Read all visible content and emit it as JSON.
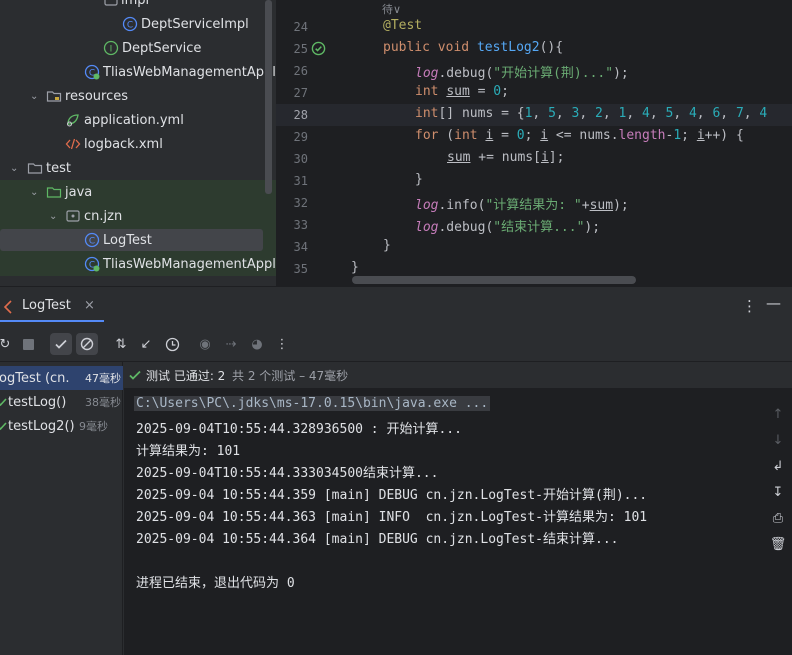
{
  "project_tree": {
    "items": [
      {
        "label": "impl",
        "kind": "package"
      },
      {
        "label": "DeptServiceImpl",
        "kind": "class"
      },
      {
        "label": "DeptService",
        "kind": "interface"
      },
      {
        "label": "TliasWebManagementApplic",
        "kind": "spring-class"
      },
      {
        "label": "resources",
        "kind": "folder"
      },
      {
        "label": "application.yml",
        "kind": "yaml"
      },
      {
        "label": "logback.xml",
        "kind": "xml"
      },
      {
        "label": "test",
        "kind": "folder"
      },
      {
        "label": "java",
        "kind": "folder-test"
      },
      {
        "label": "cn.jzn",
        "kind": "package"
      },
      {
        "label": "LogTest",
        "kind": "class"
      },
      {
        "label": "TliasWebManagementApplic",
        "kind": "spring-class"
      }
    ]
  },
  "editor": {
    "hint": "待∨",
    "lines": [
      {
        "n": "24"
      },
      {
        "n": "25"
      },
      {
        "n": "26"
      },
      {
        "n": "27"
      },
      {
        "n": "28"
      },
      {
        "n": "29"
      },
      {
        "n": "30"
      },
      {
        "n": "31"
      },
      {
        "n": "32"
      },
      {
        "n": "33"
      },
      {
        "n": "34"
      },
      {
        "n": "35"
      }
    ],
    "code": {
      "l24_ann": "@Test",
      "l25_kw1": "public",
      "l25_kw2": "void",
      "l25_fn": "testLog2",
      "l25_rest": "(){",
      "l26_log": "log",
      "l26_call": ".debug(",
      "l26_str": "\"开始计算(荆)...\"",
      "l26_end": ");",
      "l27_kw": "int",
      "l27_var": "sum",
      "l27_eq": " = ",
      "l27_num": "0",
      "l27_end": ";",
      "l28_kw": "int",
      "l28_decl": "[] nums = {",
      "l28_nums": [
        "1",
        "5",
        "3",
        "2",
        "1",
        "4",
        "5",
        "4",
        "6",
        "7",
        "4"
      ],
      "l29_for": "for",
      "l29_open": " (",
      "l29_int": "int",
      "l29_i": "i",
      "l29_eq": " = ",
      "l29_zero": "0",
      "l29_semi": "; ",
      "l29_i2": "i",
      "l29_cmp": " <= nums.",
      "l29_len": "length",
      "l29_minus": "-",
      "l29_one": "1",
      "l29_semi2": "; ",
      "l29_i3": "i",
      "l29_inc": "++) {",
      "l30_sum": "sum",
      "l30_mid": " += nums[",
      "l30_i": "i",
      "l30_end": "];",
      "l31": "}",
      "l32_log": "log",
      "l32_call": ".info(",
      "l32_str": "\"计算结果为: \"",
      "l32_plus": "+",
      "l32_sum": "sum",
      "l32_end": ");",
      "l33_log": "log",
      "l33_call": ".debug(",
      "l33_str": "\"结束计算...\"",
      "l33_end": ");",
      "l34": "}",
      "l35": "}"
    }
  },
  "run_window": {
    "tab_label": "LogTest",
    "status_text": "测试 已通过: 2",
    "status_rest": "共 2 个测试 – 47毫秒",
    "tests": [
      {
        "label": "LogTest (cn.",
        "time": "47毫秒"
      },
      {
        "label": "testLog()",
        "time": "38毫秒"
      },
      {
        "label": "testLog2()",
        "time": "9毫秒"
      }
    ],
    "console": [
      "C:\\Users\\PC\\.jdks\\ms-17.0.15\\bin\\java.exe ...",
      "2025-09-04T10:55:44.328936500 : 开始计算...",
      "计算结果为: 101",
      "2025-09-04T10:55:44.333034500结束计算...",
      "2025-09-04 10:55:44.359 [main] DEBUG cn.jzn.LogTest-开始计算(荆)...",
      "2025-09-04 10:55:44.363 [main] INFO  cn.jzn.LogTest-计算结果为: 101",
      "2025-09-04 10:55:44.364 [main] DEBUG cn.jzn.LogTest-结束计算...",
      "",
      "进程已结束，退出代码为 0"
    ]
  },
  "colors": {
    "pass_green": "#5fb865",
    "accent_blue": "#548af7",
    "selection": "#2e436e"
  }
}
